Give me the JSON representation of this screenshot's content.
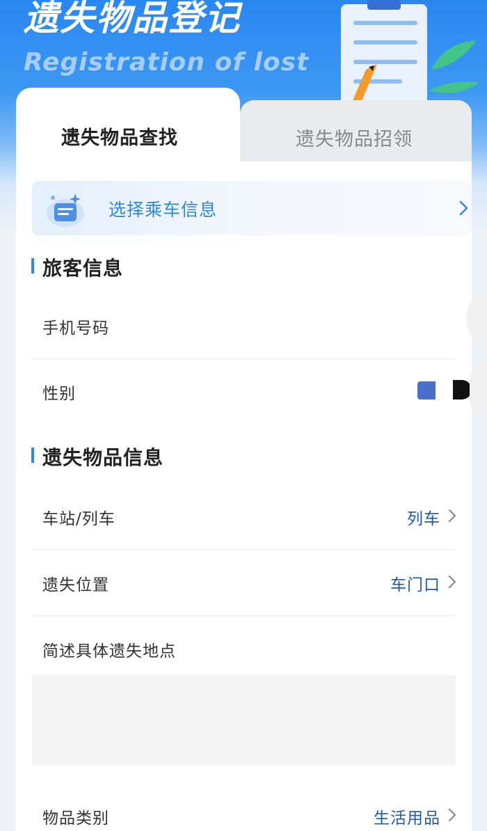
{
  "header": {
    "title": "遗失物品登记",
    "subtitle": "Registration of lost"
  },
  "tabs": [
    {
      "label": "遗失物品查找",
      "active": true
    },
    {
      "label": "遗失物品招领",
      "active": false
    }
  ],
  "trip": {
    "label": "选择乘车信息",
    "icon": "ticket-icon"
  },
  "passenger_section": {
    "title": "旅客信息",
    "phone_label": "手机号码",
    "gender_label": "性别"
  },
  "item_section": {
    "title": "遗失物品信息",
    "station_train_label": "车站/列车",
    "station_train_value": "列车",
    "location_label": "遗失位置",
    "location_value": "车门口",
    "description_label": "简述具体遗失地点",
    "category_label": "物品类别",
    "category_value": "生活用品"
  },
  "colors": {
    "accent": "#2f8ad6",
    "value_text": "#1f5aa6",
    "header_blue": "#2a87f0"
  }
}
